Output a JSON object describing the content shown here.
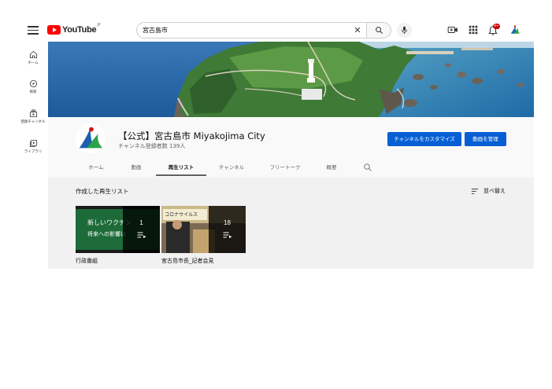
{
  "header": {
    "logo_text": "YouTube",
    "logo_region": "JP",
    "search": {
      "value": "宮古島市"
    },
    "notification_count": "9+"
  },
  "sidebar": {
    "items": [
      {
        "label": "ホーム",
        "icon": "home-icon"
      },
      {
        "label": "探索",
        "icon": "explore-icon"
      },
      {
        "label": "登録チャンネル",
        "icon": "subscriptions-icon"
      },
      {
        "label": "ライブラリ",
        "icon": "library-icon"
      }
    ]
  },
  "channel": {
    "title": "【公式】宮古島市 Miyakojima City",
    "subscribers": "チャンネル登録者数 139人",
    "customize_label": "チャンネルをカスタマイズ",
    "manage_label": "動画を管理"
  },
  "tabs": [
    {
      "label": "ホーム",
      "active": false
    },
    {
      "label": "動画",
      "active": false
    },
    {
      "label": "再生リスト",
      "active": true
    },
    {
      "label": "チャンネル",
      "active": false
    },
    {
      "label": "フリートーク",
      "active": false
    },
    {
      "label": "概要",
      "active": false
    }
  ],
  "playlists_section": {
    "title": "作成した再生リスト",
    "sort_label": "並べ替え"
  },
  "playlists": [
    {
      "title": "行政番組",
      "count": "1",
      "thumb_text_1": "新しいワクチン",
      "thumb_text_2": "将来への影響は"
    },
    {
      "title": "宮古島市長_記者会見",
      "count": "18",
      "thumb_text_1": "コロナウイルス"
    }
  ],
  "colors": {
    "accent_blue": "#065fd4",
    "logo_red": "#ff0000",
    "tab_underline": "#606060"
  }
}
